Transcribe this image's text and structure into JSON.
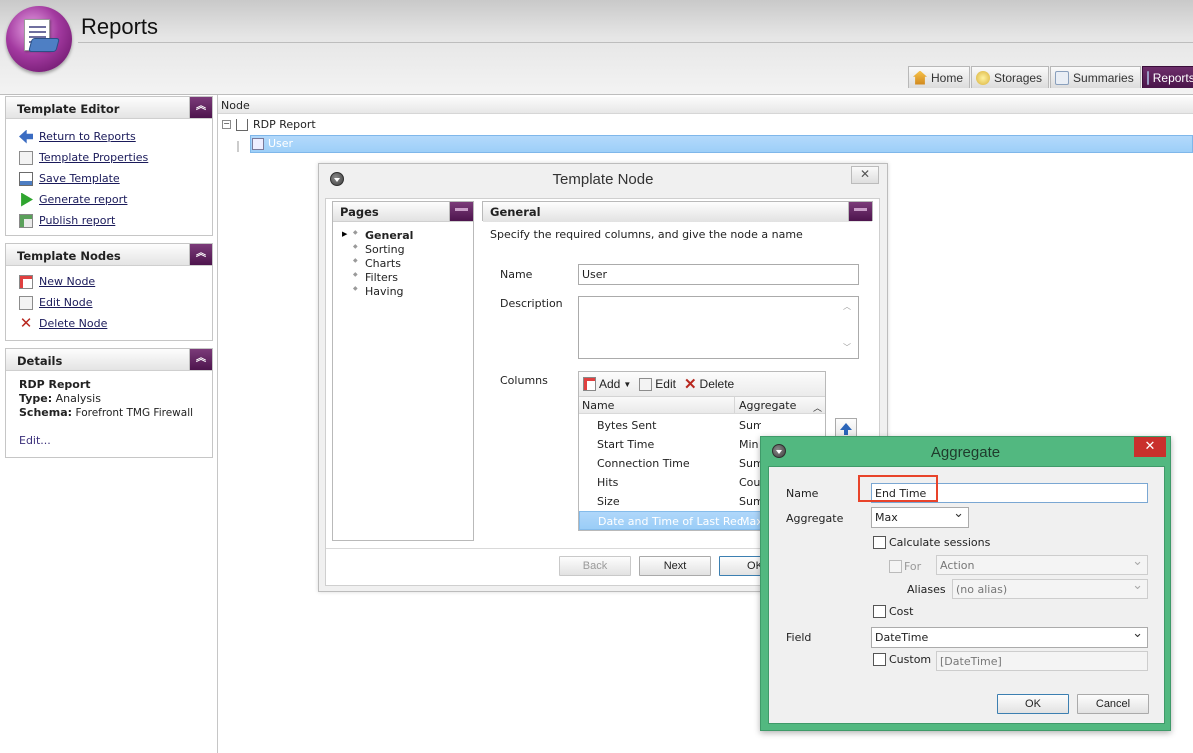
{
  "app": {
    "title": "Reports"
  },
  "tabs": [
    {
      "label": "Home",
      "icon": "home-icon"
    },
    {
      "label": "Storages",
      "icon": "storages-icon"
    },
    {
      "label": "Summaries",
      "icon": "summaries-icon"
    },
    {
      "label": "Reports",
      "icon": "reports-icon"
    }
  ],
  "template_editor": {
    "title": "Template Editor",
    "items": [
      {
        "label": "Return to Reports",
        "icon": "back-arrow-icon"
      },
      {
        "label": "Template Properties",
        "icon": "properties-icon"
      },
      {
        "label": "Save Template",
        "icon": "save-icon"
      },
      {
        "label": "Generate report",
        "icon": "play-icon"
      },
      {
        "label": "Publish report",
        "icon": "publish-icon"
      }
    ]
  },
  "template_nodes": {
    "title": "Template Nodes",
    "items": [
      {
        "label": "New Node",
        "icon": "new-node-icon"
      },
      {
        "label": "Edit Node",
        "icon": "edit-icon"
      },
      {
        "label": "Delete Node",
        "icon": "delete-x-icon"
      }
    ]
  },
  "details": {
    "title": "Details",
    "name": "RDP Report",
    "type_label": "Type:",
    "type_value": "Analysis",
    "schema_label": "Schema:",
    "schema_value": "Forefront TMG Firewall",
    "edit_label": "Edit..."
  },
  "tree": {
    "header": "Node",
    "root": "RDP Report",
    "child": "User"
  },
  "template_node_dialog": {
    "title": "Template Node",
    "pages_title": "Pages",
    "pages": [
      "General",
      "Sorting",
      "Charts",
      "Filters",
      "Having"
    ],
    "active_page": "General",
    "section_title": "General",
    "instructions": "Specify the required columns, and give the node a name",
    "name_label": "Name",
    "name_value": "User",
    "description_label": "Description",
    "description_value": "",
    "columns_label": "Columns",
    "toolbar": {
      "add": "Add",
      "edit": "Edit",
      "delete": "Delete"
    },
    "col_headers": {
      "name": "Name",
      "aggregate": "Aggregate"
    },
    "rows": [
      {
        "name": "Bytes Sent",
        "aggregate": "Sum"
      },
      {
        "name": "Start Time",
        "aggregate": "Min"
      },
      {
        "name": "Connection Time",
        "aggregate": "Sum"
      },
      {
        "name": "Hits",
        "aggregate": "Cou"
      },
      {
        "name": "Size",
        "aggregate": "Sum"
      },
      {
        "name": "Date and Time of Last Rec...",
        "aggregate": "Max"
      }
    ],
    "buttons": {
      "back": "Back",
      "next": "Next",
      "ok": "OK"
    }
  },
  "aggregate_dialog": {
    "title": "Aggregate",
    "close": "✕",
    "name_label": "Name",
    "name_value": "End Time",
    "aggregate_label": "Aggregate",
    "aggregate_value": "Max",
    "calc_sessions_label": "Calculate sessions",
    "for_label": "For",
    "for_value": "Action",
    "aliases_label": "Aliases",
    "aliases_value": "(no alias)",
    "cost_label": "Cost",
    "field_label": "Field",
    "field_value": "DateTime",
    "custom_label": "Custom",
    "custom_value": "[DateTime]",
    "ok": "OK",
    "cancel": "Cancel"
  }
}
